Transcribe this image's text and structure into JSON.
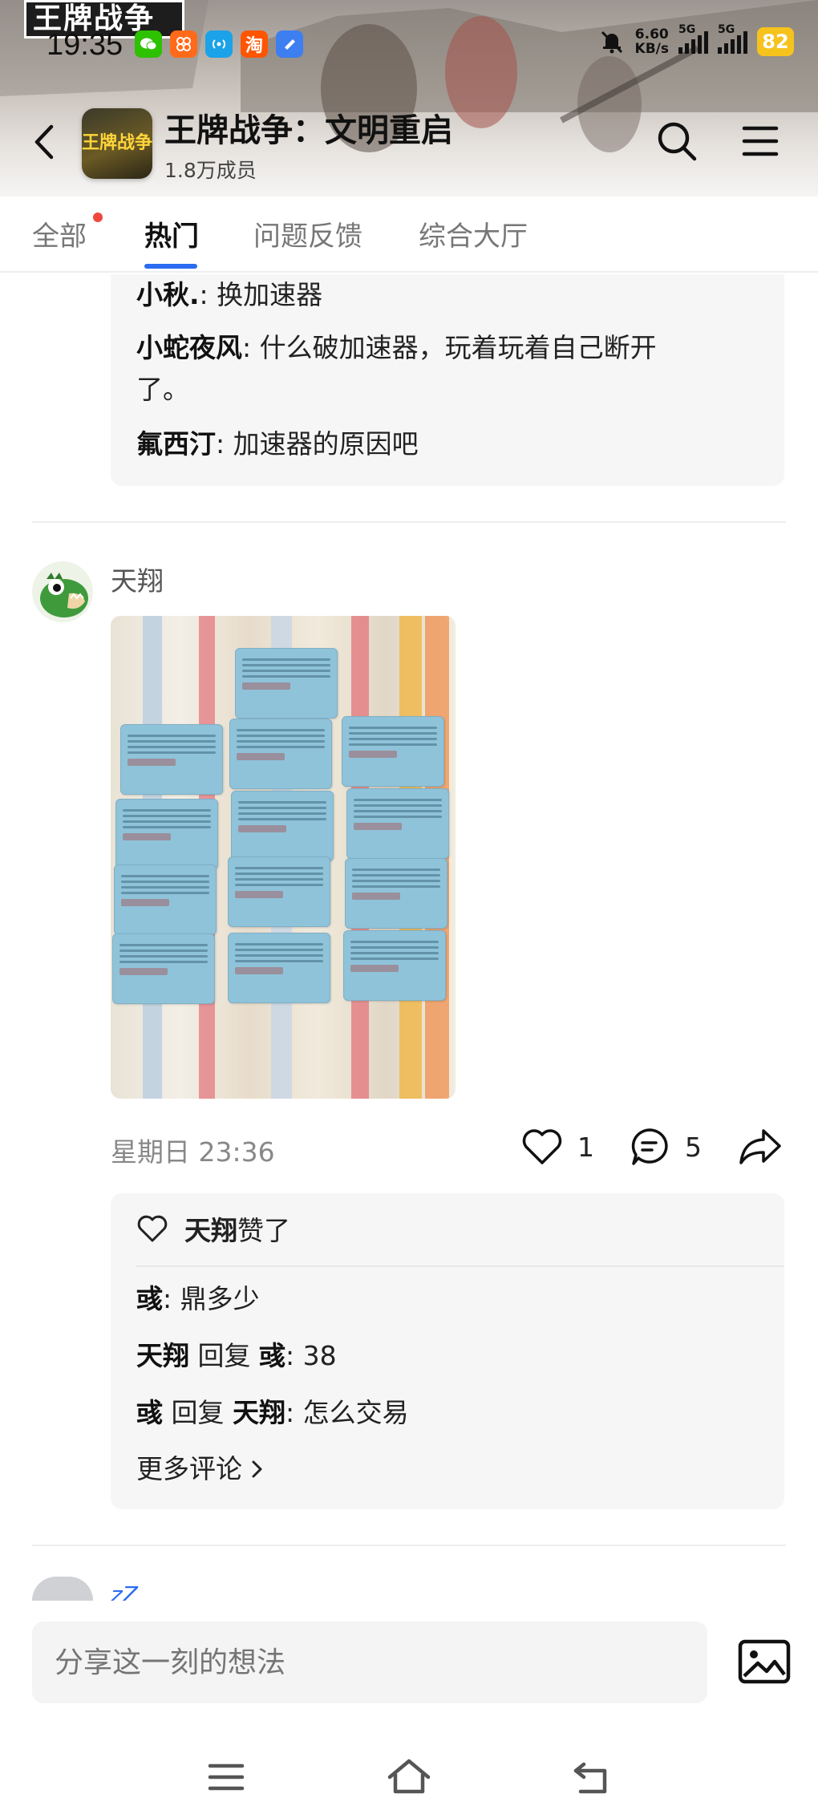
{
  "status_bar": {
    "game_stamp": "王牌战争",
    "time": "19:35",
    "net_speed_value": "6.60",
    "net_speed_unit": "KB/s",
    "signal_1_label": "5G",
    "signal_2_label": "5G",
    "battery": "82",
    "app_icons": [
      "wechat-icon",
      "app-store-icon",
      "hotspot-icon",
      "taobao-icon",
      "cloud-app-icon"
    ],
    "taobao_glyph": "淘"
  },
  "header": {
    "logo_text": "王牌战争",
    "title": "王牌战争：文明重启",
    "members": "1.8万成员"
  },
  "tabs": [
    {
      "label": "全部",
      "has_dot": true
    },
    {
      "label": "热门",
      "active": true
    },
    {
      "label": "问题反馈"
    },
    {
      "label": "综合大厅"
    }
  ],
  "prev_post": {
    "comments": [
      {
        "user": "小秋.",
        "sep": ": ",
        "text": "换加速器"
      },
      {
        "user": "小蛇夜风",
        "sep": ": ",
        "text": "什么破加速器，玩着玩着自己断开",
        "text2": "了。"
      },
      {
        "user": "氟西汀",
        "sep": ": ",
        "text": "加速器的原因吧"
      }
    ]
  },
  "post": {
    "author": "天翔",
    "time": "星期日 23:36",
    "likes": "1",
    "comments_count": "5",
    "liked_by": "天翔",
    "liked_suffix": " 赞了",
    "comments": [
      {
        "user": "彧",
        "sep": ": ",
        "text": "鼎多少"
      },
      {
        "user": "天翔",
        "mid": " 回复 ",
        "target": "彧",
        "sep": ": ",
        "text": "38"
      },
      {
        "user": "彧",
        "mid": " 回复 ",
        "target": "天翔",
        "sep": ": ",
        "text": "怎么交易"
      }
    ],
    "more_comments": "更多评论"
  },
  "next_post": {
    "author_partial": "zZ"
  },
  "input": {
    "placeholder": "分享这一刻的想法"
  },
  "colors": {
    "accent": "#2b6cf2",
    "notify_dot": "#f0463c",
    "battery": "#f6c21c"
  }
}
